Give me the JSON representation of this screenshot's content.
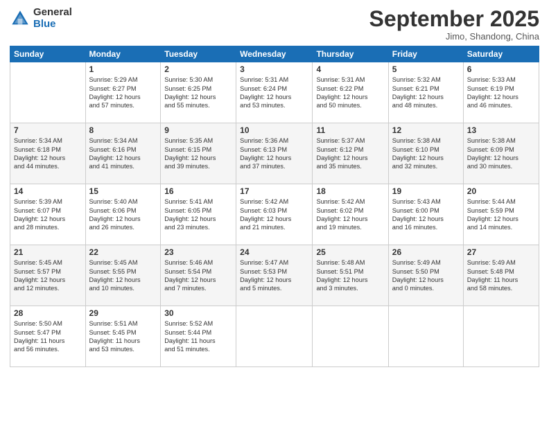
{
  "header": {
    "logo_general": "General",
    "logo_blue": "Blue",
    "month_title": "September 2025",
    "location": "Jimo, Shandong, China"
  },
  "days_of_week": [
    "Sunday",
    "Monday",
    "Tuesday",
    "Wednesday",
    "Thursday",
    "Friday",
    "Saturday"
  ],
  "weeks": [
    [
      {
        "day": "",
        "content": ""
      },
      {
        "day": "1",
        "content": "Sunrise: 5:29 AM\nSunset: 6:27 PM\nDaylight: 12 hours\nand 57 minutes."
      },
      {
        "day": "2",
        "content": "Sunrise: 5:30 AM\nSunset: 6:25 PM\nDaylight: 12 hours\nand 55 minutes."
      },
      {
        "day": "3",
        "content": "Sunrise: 5:31 AM\nSunset: 6:24 PM\nDaylight: 12 hours\nand 53 minutes."
      },
      {
        "day": "4",
        "content": "Sunrise: 5:31 AM\nSunset: 6:22 PM\nDaylight: 12 hours\nand 50 minutes."
      },
      {
        "day": "5",
        "content": "Sunrise: 5:32 AM\nSunset: 6:21 PM\nDaylight: 12 hours\nand 48 minutes."
      },
      {
        "day": "6",
        "content": "Sunrise: 5:33 AM\nSunset: 6:19 PM\nDaylight: 12 hours\nand 46 minutes."
      }
    ],
    [
      {
        "day": "7",
        "content": "Sunrise: 5:34 AM\nSunset: 6:18 PM\nDaylight: 12 hours\nand 44 minutes."
      },
      {
        "day": "8",
        "content": "Sunrise: 5:34 AM\nSunset: 6:16 PM\nDaylight: 12 hours\nand 41 minutes."
      },
      {
        "day": "9",
        "content": "Sunrise: 5:35 AM\nSunset: 6:15 PM\nDaylight: 12 hours\nand 39 minutes."
      },
      {
        "day": "10",
        "content": "Sunrise: 5:36 AM\nSunset: 6:13 PM\nDaylight: 12 hours\nand 37 minutes."
      },
      {
        "day": "11",
        "content": "Sunrise: 5:37 AM\nSunset: 6:12 PM\nDaylight: 12 hours\nand 35 minutes."
      },
      {
        "day": "12",
        "content": "Sunrise: 5:38 AM\nSunset: 6:10 PM\nDaylight: 12 hours\nand 32 minutes."
      },
      {
        "day": "13",
        "content": "Sunrise: 5:38 AM\nSunset: 6:09 PM\nDaylight: 12 hours\nand 30 minutes."
      }
    ],
    [
      {
        "day": "14",
        "content": "Sunrise: 5:39 AM\nSunset: 6:07 PM\nDaylight: 12 hours\nand 28 minutes."
      },
      {
        "day": "15",
        "content": "Sunrise: 5:40 AM\nSunset: 6:06 PM\nDaylight: 12 hours\nand 26 minutes."
      },
      {
        "day": "16",
        "content": "Sunrise: 5:41 AM\nSunset: 6:05 PM\nDaylight: 12 hours\nand 23 minutes."
      },
      {
        "day": "17",
        "content": "Sunrise: 5:42 AM\nSunset: 6:03 PM\nDaylight: 12 hours\nand 21 minutes."
      },
      {
        "day": "18",
        "content": "Sunrise: 5:42 AM\nSunset: 6:02 PM\nDaylight: 12 hours\nand 19 minutes."
      },
      {
        "day": "19",
        "content": "Sunrise: 5:43 AM\nSunset: 6:00 PM\nDaylight: 12 hours\nand 16 minutes."
      },
      {
        "day": "20",
        "content": "Sunrise: 5:44 AM\nSunset: 5:59 PM\nDaylight: 12 hours\nand 14 minutes."
      }
    ],
    [
      {
        "day": "21",
        "content": "Sunrise: 5:45 AM\nSunset: 5:57 PM\nDaylight: 12 hours\nand 12 minutes."
      },
      {
        "day": "22",
        "content": "Sunrise: 5:45 AM\nSunset: 5:55 PM\nDaylight: 12 hours\nand 10 minutes."
      },
      {
        "day": "23",
        "content": "Sunrise: 5:46 AM\nSunset: 5:54 PM\nDaylight: 12 hours\nand 7 minutes."
      },
      {
        "day": "24",
        "content": "Sunrise: 5:47 AM\nSunset: 5:53 PM\nDaylight: 12 hours\nand 5 minutes."
      },
      {
        "day": "25",
        "content": "Sunrise: 5:48 AM\nSunset: 5:51 PM\nDaylight: 12 hours\nand 3 minutes."
      },
      {
        "day": "26",
        "content": "Sunrise: 5:49 AM\nSunset: 5:50 PM\nDaylight: 12 hours\nand 0 minutes."
      },
      {
        "day": "27",
        "content": "Sunrise: 5:49 AM\nSunset: 5:48 PM\nDaylight: 11 hours\nand 58 minutes."
      }
    ],
    [
      {
        "day": "28",
        "content": "Sunrise: 5:50 AM\nSunset: 5:47 PM\nDaylight: 11 hours\nand 56 minutes."
      },
      {
        "day": "29",
        "content": "Sunrise: 5:51 AM\nSunset: 5:45 PM\nDaylight: 11 hours\nand 53 minutes."
      },
      {
        "day": "30",
        "content": "Sunrise: 5:52 AM\nSunset: 5:44 PM\nDaylight: 11 hours\nand 51 minutes."
      },
      {
        "day": "",
        "content": ""
      },
      {
        "day": "",
        "content": ""
      },
      {
        "day": "",
        "content": ""
      },
      {
        "day": "",
        "content": ""
      }
    ]
  ]
}
